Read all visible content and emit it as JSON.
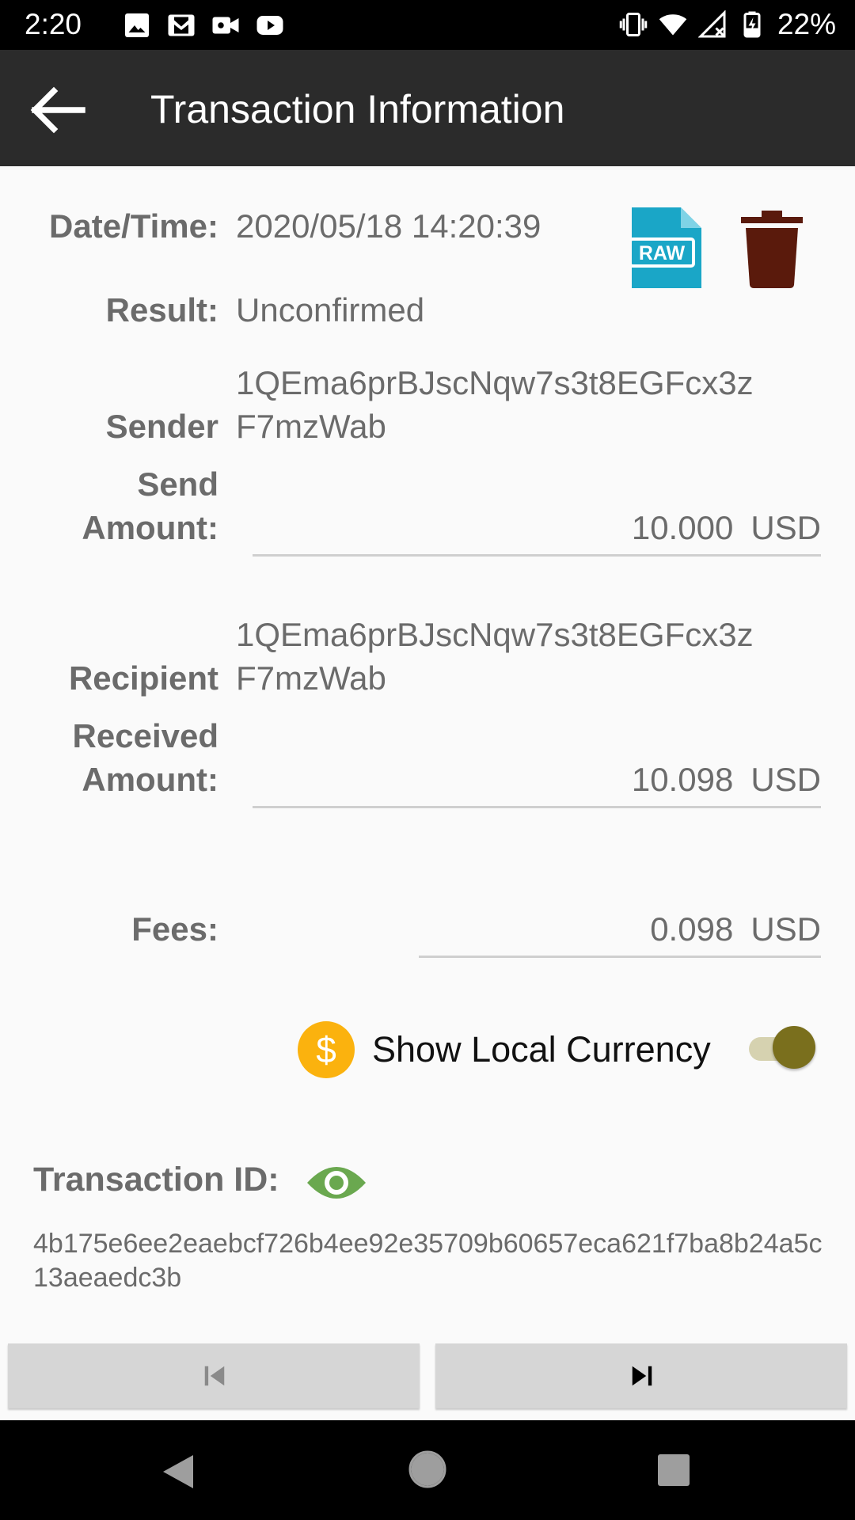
{
  "status_bar": {
    "time": "2:20",
    "battery": "22%",
    "icons_left": [
      "image-icon",
      "gmail-icon",
      "video-camera-icon",
      "youtube-icon"
    ],
    "icons_right": [
      "vibrate-icon",
      "wifi-icon",
      "signal-icon",
      "battery-charging-icon"
    ]
  },
  "app_bar": {
    "title": "Transaction Information"
  },
  "details": {
    "datetime_label": "Date/Time:",
    "datetime_value": "2020/05/18 14:20:39",
    "result_label": "Result:",
    "result_value": "Unconfirmed",
    "sender_label": "Sender",
    "sender_line1": "1QEma6prBJscNqw7s3t8EGFcx3z",
    "sender_line2": "F7mzWab",
    "send_amount_label_line1": "Send",
    "send_amount_label_line2": "Amount:",
    "send_amount_value": "10.000",
    "send_amount_currency": "USD",
    "recipient_label": "Recipient",
    "recipient_line1": "1QEma6prBJscNqw7s3t8EGFcx3z",
    "recipient_line2": "F7mzWab",
    "received_amount_label_line1": "Received",
    "received_amount_label_line2": "Amount:",
    "received_amount_value": "10.098",
    "received_amount_currency": "USD",
    "fees_label": "Fees:",
    "fees_value": "0.098",
    "fees_currency": "USD"
  },
  "local_currency": {
    "label": "Show Local Currency",
    "enabled": true
  },
  "transaction": {
    "id_label": "Transaction ID:",
    "id_value": "4b175e6ee2eaebcf726b4ee92e35709b60657eca621f7ba8b24a5c13aeaedc3b"
  },
  "colors": {
    "app_bar": "#2b2b2b",
    "raw_icon": "#1aa6c7",
    "trash_icon": "#5a1a0c",
    "dollar_icon": "#fbb20e",
    "eye_icon": "#6aa84f",
    "toggle_thumb": "#7a6f1d"
  }
}
